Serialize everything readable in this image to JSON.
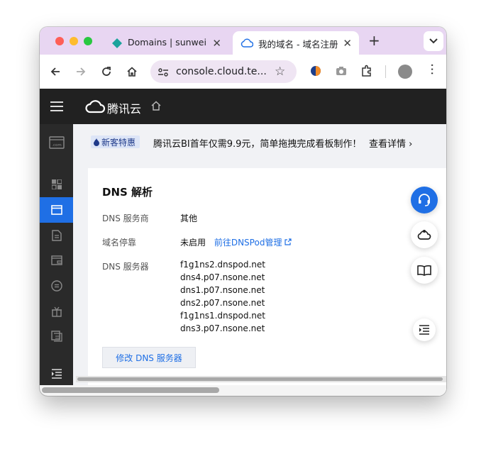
{
  "browser": {
    "tabs": [
      {
        "title": "Domains | sunwei | N",
        "icon": "diamond-icon",
        "active": false
      },
      {
        "title": "我的域名 - 域名注册",
        "icon": "cloud-icon",
        "active": true
      }
    ],
    "new_tab_label": "+",
    "address": "console.cloud.te..."
  },
  "console": {
    "brand": "腾讯云",
    "sidebar": {
      "items": [
        "dotcom-icon",
        "grid-icon",
        "browser-window-icon",
        "doc-icon",
        "wallet-icon",
        "coin-icon",
        "gift-icon",
        "copy-icon",
        "collapse-icon"
      ],
      "active_index": 2
    },
    "banner": {
      "badge": "新客特惠",
      "text": "腾讯云BI首年仅需9.9元，简单拖拽完成看板制作！",
      "link": "查看详情"
    },
    "card": {
      "title": "DNS 解析",
      "dns_provider_label": "DNS 服务商",
      "dns_provider_value": "其他",
      "parking_label": "域名停靠",
      "parking_value": "未启用",
      "parking_link": "前往DNSPod管理",
      "servers_label": "DNS 服务器",
      "servers": [
        "f1g1ns2.dnspod.net",
        "dns4.p07.nsone.net",
        "dns1.p07.nsone.net",
        "dns2.p07.nsone.net",
        "f1g1ns1.dnspod.net",
        "dns3.p07.nsone.net"
      ],
      "modify_button": "修改 DNS 服务器"
    },
    "floating_buttons": [
      "headset-icon",
      "cloud-user-icon",
      "book-icon",
      "menu-indent-icon"
    ]
  },
  "colors": {
    "accent": "#1f6fe5",
    "tabbar": "#e8d6f2",
    "topnav": "#212121",
    "sidebar": "#2a2a2a"
  }
}
